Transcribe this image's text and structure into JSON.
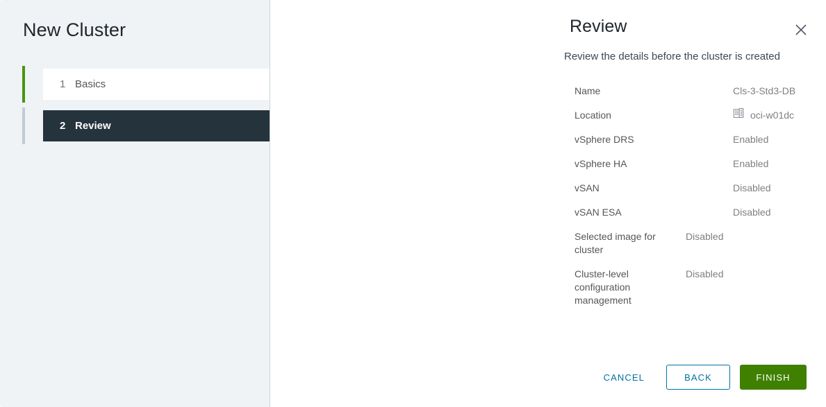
{
  "wizard": {
    "title": "New Cluster",
    "steps": [
      {
        "number": "1",
        "label": "Basics",
        "state": "complete"
      },
      {
        "number": "2",
        "label": "Review",
        "state": "active"
      }
    ]
  },
  "page": {
    "title": "Review",
    "subtitle": "Review the details before the cluster is created"
  },
  "summary": {
    "rows": [
      {
        "label": "Name",
        "value": "Cls-3-Std3-DB",
        "icon": ""
      },
      {
        "label": "Location",
        "value": "oci-w01dc",
        "icon": "datacenter-icon"
      },
      {
        "label": "vSphere DRS",
        "value": "Enabled",
        "icon": ""
      },
      {
        "label": "vSphere HA",
        "value": "Enabled",
        "icon": ""
      },
      {
        "label": "vSAN",
        "value": "Disabled",
        "icon": ""
      },
      {
        "label": "vSAN ESA",
        "value": "Disabled",
        "icon": ""
      },
      {
        "label": "Selected image for cluster",
        "value": "Disabled",
        "icon": ""
      },
      {
        "label": "Cluster-level configuration management",
        "value": "Disabled",
        "icon": ""
      }
    ]
  },
  "footer": {
    "cancel_label": "CANCEL",
    "back_label": "BACK",
    "finish_label": "FINISH"
  },
  "icons": {
    "close": "close-icon"
  },
  "colors": {
    "accent_blue": "#0072a3",
    "primary_green": "#3f8000",
    "step_complete_bar": "#48960c",
    "step_pending_bar": "#c1ccd3",
    "step_active_bg": "#25333d",
    "nav_bg": "#eff3f6"
  }
}
